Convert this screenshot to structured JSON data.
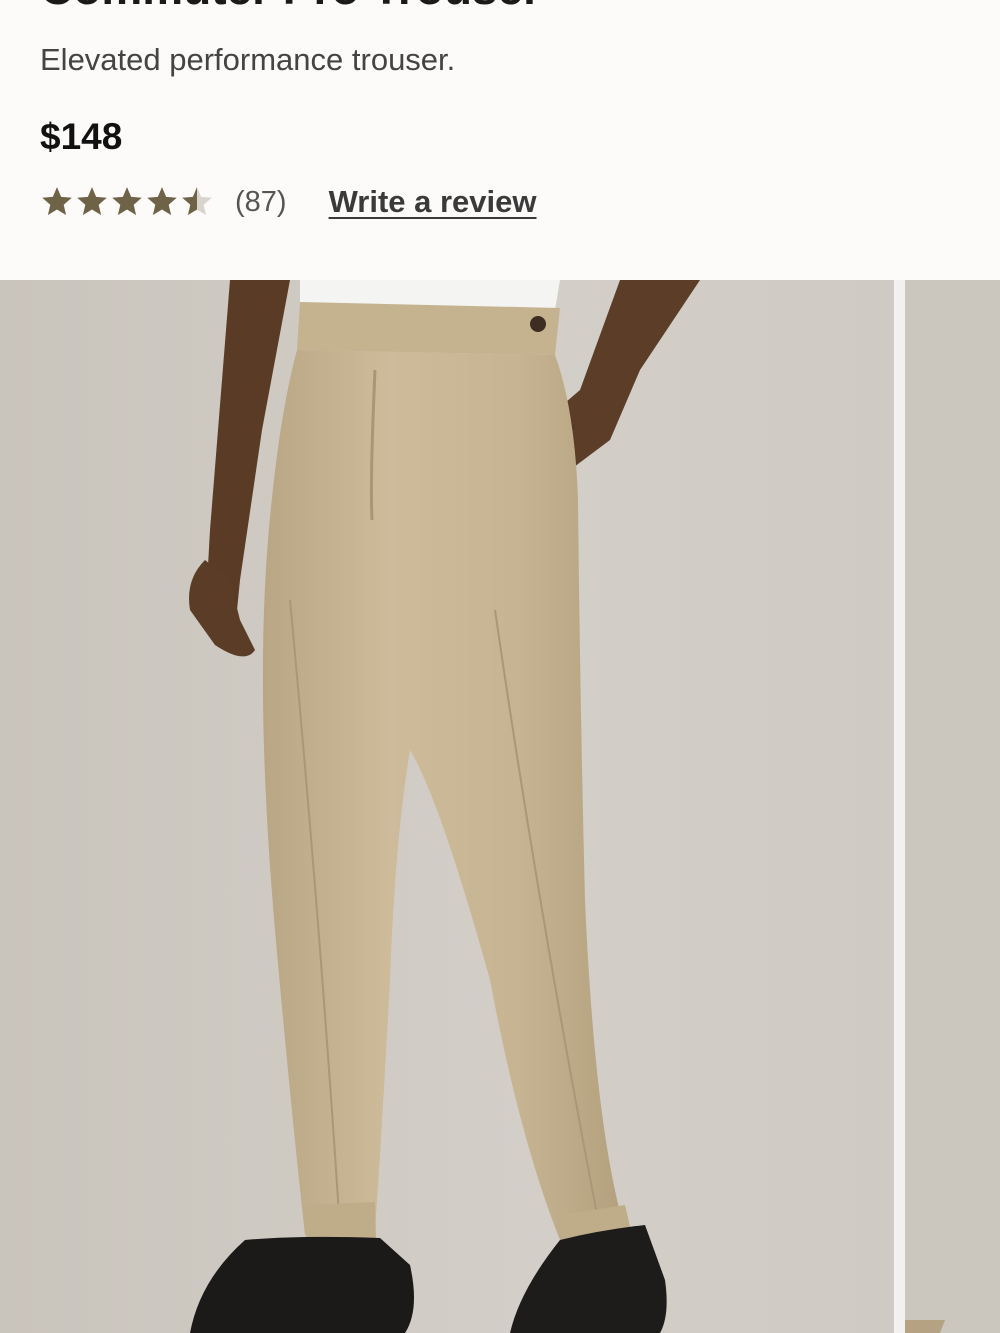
{
  "product": {
    "title": "Commuter Pro Trouser",
    "subtitle": "Elevated performance trouser.",
    "price": "$148",
    "rating": 4.5,
    "rating_max": 5,
    "review_count": "(87)",
    "write_review_label": "Write a review"
  },
  "colors": {
    "star_fill": "#6f6347",
    "star_empty": "#d9d4cc",
    "background_photo": "#cdc8c1",
    "trouser": "#c9b796"
  }
}
